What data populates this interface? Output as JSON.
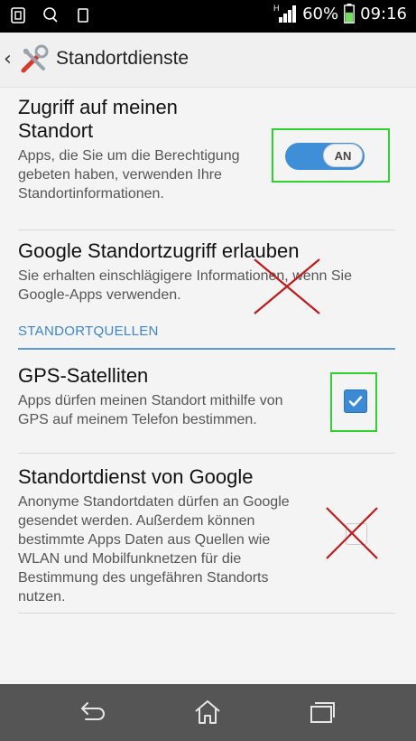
{
  "status_bar": {
    "network_type": "H",
    "battery_percent": "60%",
    "time": "09:16",
    "icons": [
      "screenshot-icon",
      "location-icon",
      "notification-icon",
      "signal-icon",
      "battery-icon"
    ],
    "battery_level": 0.6
  },
  "action_bar": {
    "back_symbol": "‹",
    "title": "Standortdienste",
    "app_icon": "tools-icon"
  },
  "sections": {
    "access": {
      "title": "Zugriff auf meinen Standort",
      "summary": "Apps, die Sie um die Berechtigung gebeten haben, verwenden Ihre Standortinformationen.",
      "toggle_label": "AN",
      "toggle_on": true
    },
    "google_access": {
      "title": "Google Standortzugriff erlauben",
      "summary": "Sie erhalten einschlägigere Informationen, wenn Sie Google-Apps verwenden."
    },
    "category": "STANDORTQUELLEN",
    "gps": {
      "title": "GPS-Satelliten",
      "summary": "Apps dürfen meinen Standort mithilfe von GPS auf meinem Telefon bestimmen.",
      "checked": true
    },
    "google_service": {
      "title": "Standortdienst von Google",
      "summary": "Anonyme Standortdaten dürfen an Google gesendet werden. Außerdem können bestimmte Apps Daten aus Quellen wie WLAN und Mobilfunknetzen für die Bestimmung des ungefähren Standorts nutzen.",
      "checked": false
    }
  },
  "colors": {
    "accent": "#3e8fd8",
    "highlight": "#2dd42d",
    "cross": "#c21a1a",
    "navbar": "#555555"
  },
  "nav_bar": {
    "icons": [
      "back-icon",
      "home-icon",
      "recent-apps-icon"
    ]
  }
}
